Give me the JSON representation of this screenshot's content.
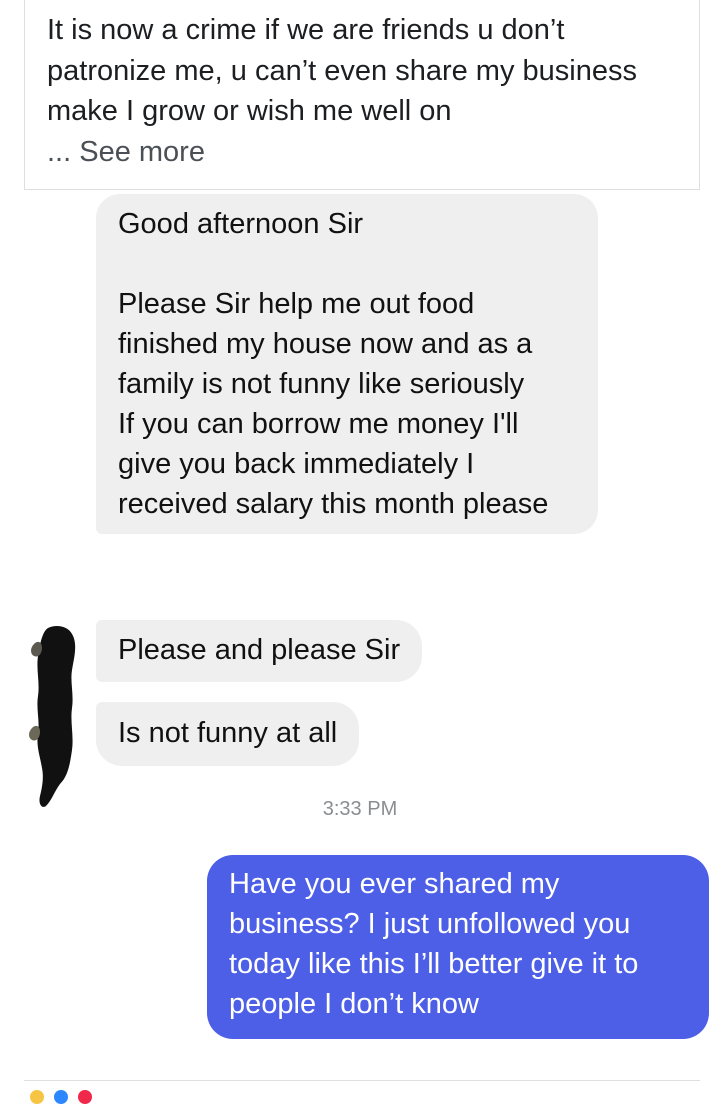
{
  "post": {
    "text": "It is now a crime if we are friends u don’t patronize me, u can’t even share my business make I grow or wish me well on",
    "see_more_label": "... See more"
  },
  "conversation": {
    "incoming": [
      {
        "lines": [
          "Good afternoon Sir",
          "",
          "Please Sir help me out food finished my house now and as a family is not funny like seriously",
          "If you can borrow me money I'll give you back immediately I received salary this month please"
        ]
      },
      {
        "text": "Please and please Sir"
      },
      {
        "text": "Is not funny at all"
      }
    ],
    "timestamp": "3:33 PM",
    "outgoing": [
      {
        "text": "Have you ever shared my business? I just unfollowed you today like this I’ll better give it to people I don’t know"
      }
    ]
  },
  "colors": {
    "incoming_bubble": "#efeff0",
    "outgoing_bubble": "#4c5fe6",
    "timestamp": "#8a8d91",
    "reaction_yellow": "#f7c544",
    "reaction_blue": "#2d88ff",
    "reaction_red": "#f0284a"
  }
}
